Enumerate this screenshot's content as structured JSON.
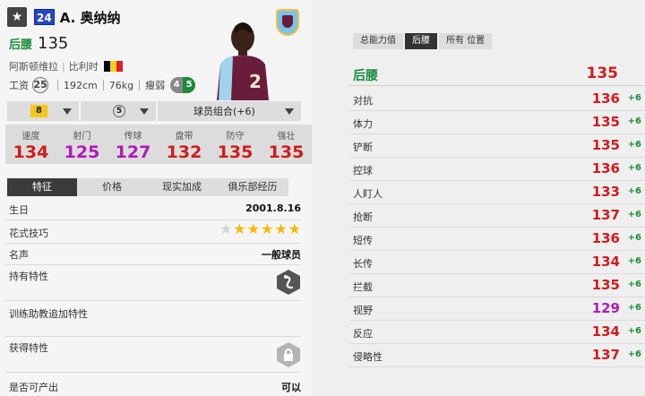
{
  "header": {
    "star_icon": "★",
    "season_badge": "24",
    "player_name": "A. 奥纳纳",
    "position": "后腰",
    "rating": "135",
    "club": "阿斯顿维拉",
    "separator": "|",
    "nation": "比利时",
    "salary_label": "工资",
    "salary": "25",
    "height": "192cm",
    "weight": "76kg",
    "body_type": "瘦弱",
    "weak_foot": "4",
    "skill_moves": "5",
    "flag_colors": [
      "#000000",
      "#f5d218",
      "#e01d2a"
    ],
    "club_badge_colors": [
      "#7ac3ea",
      "#6a1d3a",
      "#efc33a"
    ]
  },
  "selectors": {
    "level": "8",
    "mastery": "5",
    "team_color": "球员组合(+6)"
  },
  "stats": [
    {
      "label": "速度",
      "value": "134",
      "color": "#d01c1c"
    },
    {
      "label": "射门",
      "value": "125",
      "color": "#b01ab8"
    },
    {
      "label": "传球",
      "value": "127",
      "color": "#b01ab8"
    },
    {
      "label": "盘带",
      "value": "132",
      "color": "#d01c1c"
    },
    {
      "label": "防守",
      "value": "135",
      "color": "#d01c1c"
    },
    {
      "label": "强壮",
      "value": "135",
      "color": "#d01c1c"
    }
  ],
  "tabs": [
    "特征",
    "价格",
    "现实加成",
    "俱乐部经历"
  ],
  "details": {
    "birthday_label": "生日",
    "birthday": "2001.8.16",
    "skill_label": "花式技巧",
    "skill_stars": 5,
    "reputation_label": "名声",
    "reputation": "一般球员",
    "traits_label": "持有特性",
    "coach_traits_label": "训练助教追加特性",
    "acquire_traits_label": "获得特性",
    "producible_label": "是否可产出",
    "producible": "可以"
  },
  "right_tabs": [
    "总能力值",
    "后腰",
    "所有 位置"
  ],
  "main_attr": {
    "name": "后腰",
    "value": "135"
  },
  "attributes": [
    {
      "name": "对抗",
      "value": "136",
      "bonus": "+6",
      "color": "#d01c1c"
    },
    {
      "name": "体力",
      "value": "135",
      "bonus": "+6",
      "color": "#d01c1c"
    },
    {
      "name": "铲断",
      "value": "135",
      "bonus": "+6",
      "color": "#d01c1c"
    },
    {
      "name": "控球",
      "value": "136",
      "bonus": "+6",
      "color": "#d01c1c"
    },
    {
      "name": "人盯人",
      "value": "133",
      "bonus": "+6",
      "color": "#d01c1c"
    },
    {
      "name": "抢断",
      "value": "137",
      "bonus": "+6",
      "color": "#d01c1c"
    },
    {
      "name": "短传",
      "value": "136",
      "bonus": "+6",
      "color": "#d01c1c"
    },
    {
      "name": "长传",
      "value": "134",
      "bonus": "+6",
      "color": "#d01c1c"
    },
    {
      "name": "拦截",
      "value": "135",
      "bonus": "+6",
      "color": "#d01c1c"
    },
    {
      "name": "视野",
      "value": "129",
      "bonus": "+6",
      "color": "#b01ab8"
    },
    {
      "name": "反应",
      "value": "134",
      "bonus": "+6",
      "color": "#d01c1c"
    },
    {
      "name": "侵略性",
      "value": "137",
      "bonus": "+6",
      "color": "#d01c1c"
    }
  ]
}
